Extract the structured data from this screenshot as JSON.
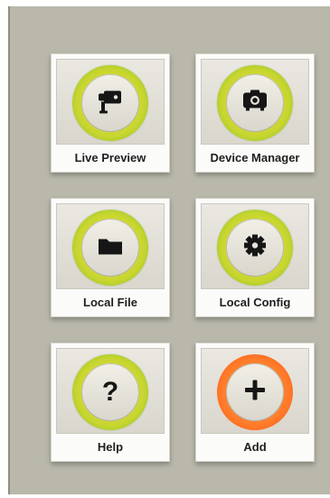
{
  "screen": {
    "tiles": [
      {
        "label": "Live Preview",
        "icon": "camera-icon",
        "ring": "green"
      },
      {
        "label": "Device Manager",
        "icon": "device-icon",
        "ring": "green"
      },
      {
        "label": "Local File",
        "icon": "folder-icon",
        "ring": "green"
      },
      {
        "label": "Local Config",
        "icon": "gear-icon",
        "ring": "green"
      },
      {
        "label": "Help",
        "icon": "question-icon",
        "ring": "green"
      },
      {
        "label": "Add",
        "icon": "plus-icon",
        "ring": "orange"
      }
    ],
    "help_glyph": "?",
    "colors": {
      "panel": "#b9b8ab",
      "ring_green": "#c9d62f",
      "ring_orange": "#ff7b2a",
      "label_text": "#1f1f1f"
    }
  }
}
